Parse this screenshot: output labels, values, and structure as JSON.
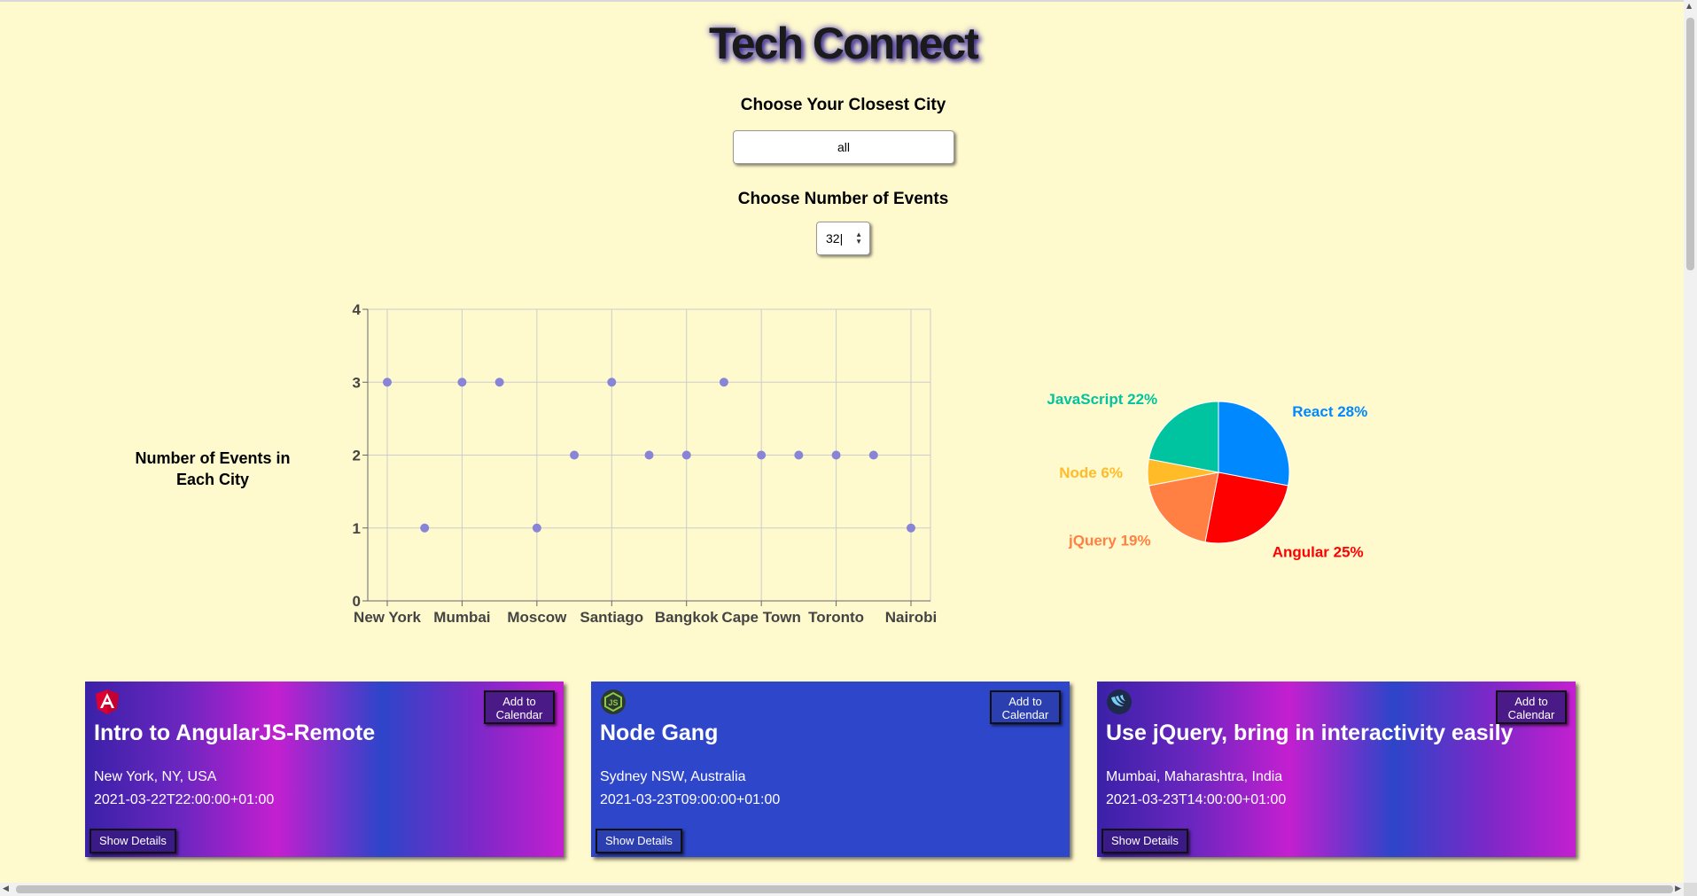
{
  "app_title": "Tech Connect",
  "city": {
    "label": "Choose Your Closest City",
    "value": "all"
  },
  "events_count": {
    "label": "Choose Number of Events",
    "value": "32"
  },
  "scatter_caption": "Number of Events in Each City",
  "cards": [
    {
      "icon": "angular-icon",
      "add_label": "Add to Calendar",
      "title": "Intro to AngularJS-Remote",
      "location": "New York, NY, USA",
      "datetime": "2021-03-22T22:00:00+01:00",
      "details_label": "Show Details"
    },
    {
      "icon": "nodejs-icon",
      "add_label": "Add to Calendar",
      "title": "Node Gang",
      "location": "Sydney NSW, Australia",
      "datetime": "2021-03-23T09:00:00+01:00",
      "details_label": "Show Details"
    },
    {
      "icon": "jquery-icon",
      "add_label": "Add to Calendar",
      "title": "Use jQuery, bring in interactivity easily",
      "location": "Mumbai, Maharashtra, India",
      "datetime": "2021-03-23T14:00:00+01:00",
      "details_label": "Show Details"
    }
  ],
  "colors": {
    "background": "#fffacd",
    "scatter_dot": "#8884d8"
  },
  "chart_data": [
    {
      "type": "scatter",
      "x_tick_labels": [
        "New York",
        "Mumbai",
        "Moscow",
        "Santiago",
        "Bangkok",
        "Cape Town",
        "Toronto",
        "Nairobi"
      ],
      "points": [
        {
          "x": 0,
          "y": 3
        },
        {
          "x": 1,
          "y": 1
        },
        {
          "x": 2,
          "y": 3
        },
        {
          "x": 3,
          "y": 3
        },
        {
          "x": 4,
          "y": 1
        },
        {
          "x": 5,
          "y": 2
        },
        {
          "x": 6,
          "y": 3
        },
        {
          "x": 7,
          "y": 2
        },
        {
          "x": 8,
          "y": 2
        },
        {
          "x": 9,
          "y": 3
        },
        {
          "x": 10,
          "y": 2
        },
        {
          "x": 11,
          "y": 2
        },
        {
          "x": 12,
          "y": 2
        },
        {
          "x": 13,
          "y": 2
        },
        {
          "x": 14,
          "y": 1
        }
      ],
      "x_tick_positions": [
        0,
        2,
        4,
        6,
        8,
        10,
        12,
        14
      ],
      "xlim": [
        0,
        14
      ],
      "ylim": [
        0,
        4
      ],
      "y_ticks": [
        0,
        1,
        2,
        3,
        4
      ],
      "grid": true,
      "dot_color": "#8884d8"
    },
    {
      "type": "pie",
      "slices": [
        {
          "label": "React",
          "value": 28,
          "color": "#0088FE",
          "text": "React 28%"
        },
        {
          "label": "Angular",
          "value": 25,
          "color": "#FF0000",
          "text": "Angular 25%"
        },
        {
          "label": "jQuery",
          "value": 19,
          "color": "#FF8042",
          "text": "jQuery 19%"
        },
        {
          "label": "Node",
          "value": 6,
          "color": "#FFBB28",
          "text": "Node 6%"
        },
        {
          "label": "JavaScript",
          "value": 22,
          "color": "#00C49F",
          "text": "JavaScript 22%"
        }
      ]
    }
  ]
}
